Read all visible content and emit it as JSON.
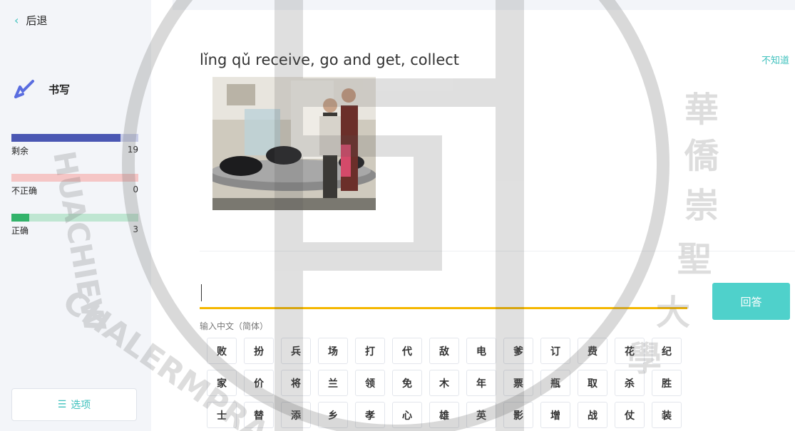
{
  "sidebar": {
    "back_label": "后退",
    "mode_label": "书写",
    "mode_icon": "pen-icon",
    "stats": {
      "remaining": {
        "label": "剩余",
        "value": "19",
        "fill_fraction": 0.86,
        "color": "#4a57b3"
      },
      "incorrect": {
        "label": "不正确",
        "value": "0",
        "fill_fraction": 0,
        "color": "#e96e6e"
      },
      "correct": {
        "label": "正确",
        "value": "3",
        "fill_fraction": 0.14,
        "color": "#33b36b"
      }
    },
    "options_label": "选项",
    "options_icon": "menu-icon"
  },
  "main": {
    "prompt": "lǐng qǔ receive, go and get, collect",
    "dont_know_label": "不知道",
    "photo_icon": "baggage-claim-photo",
    "answer_value": "",
    "answer_button_label": "回答",
    "input_hint": "输入中文（简体）",
    "keys": [
      "败",
      "扮",
      "兵",
      "场",
      "打",
      "代",
      "敌",
      "电",
      "爹",
      "订",
      "费",
      "花",
      "纪",
      "家",
      "价",
      "将",
      "兰",
      "领",
      "免",
      "木",
      "年",
      "票",
      "瓶",
      "取",
      "杀",
      "胜",
      "士",
      "替",
      "添",
      "乡",
      "孝",
      "心",
      "雄",
      "英",
      "影",
      "增",
      "战",
      "仗",
      "装"
    ]
  },
  "watermark": {
    "text_left": "HUACHIEW CHALERMPRAKIET",
    "text_right": "華僑崇聖大學"
  },
  "colors": {
    "accent": "#3fc1bd",
    "answer_button": "#4fd1cb",
    "input_underline": "#f5b700"
  }
}
